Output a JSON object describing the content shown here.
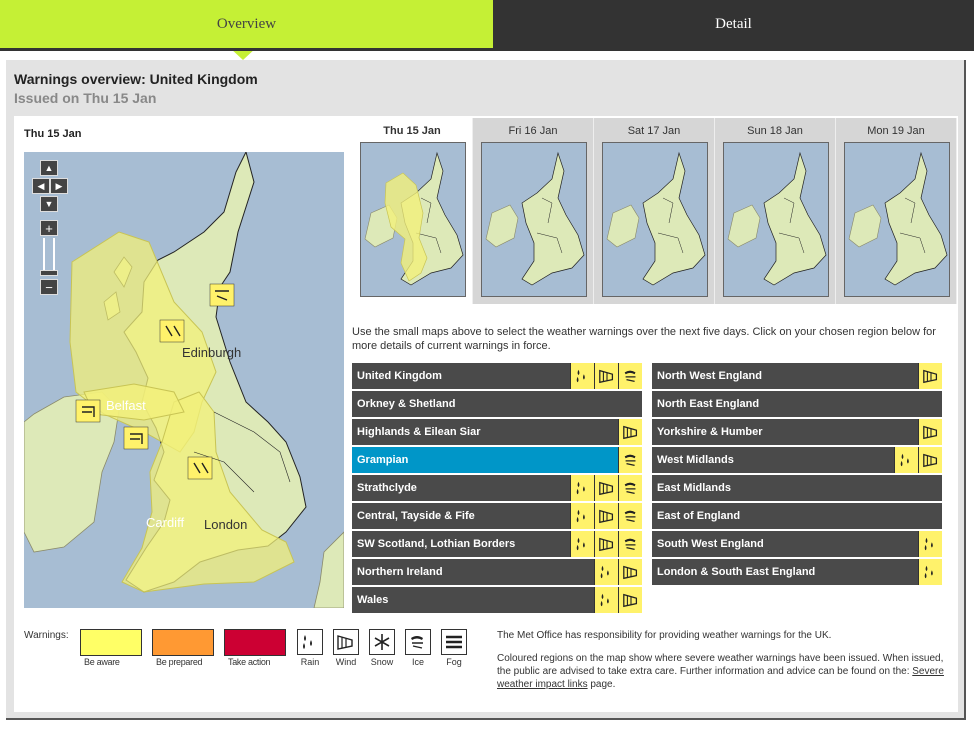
{
  "tabs": {
    "overview": "Overview",
    "detail": "Detail"
  },
  "header": {
    "title": "Warnings overview: United Kingdom",
    "issued": "Issued on Thu 15 Jan"
  },
  "main_map": {
    "date": "Thu 15 Jan",
    "labels": {
      "edinburgh": "Edinburgh",
      "belfast": "Belfast",
      "cardiff": "Cardiff",
      "london": "London"
    }
  },
  "thumbnails": [
    {
      "label": "Thu 15 Jan",
      "active": true
    },
    {
      "label": "Fri 16 Jan",
      "active": false
    },
    {
      "label": "Sat 17 Jan",
      "active": false
    },
    {
      "label": "Sun 18 Jan",
      "active": false
    },
    {
      "label": "Mon 19 Jan",
      "active": false
    }
  ],
  "instructions": "Use the small maps above to select the weather warnings over the next five days. Click on your chosen region below for more details of current warnings in force.",
  "regions_left": [
    {
      "name": "United Kingdom",
      "icons": [
        "rain-icon",
        "wind-icon",
        "ice-icon"
      ]
    },
    {
      "name": "Orkney & Shetland",
      "icons": []
    },
    {
      "name": "Highlands & Eilean Siar",
      "icons": [
        "wind-icon"
      ]
    },
    {
      "name": "Grampian",
      "icons": [
        "ice-icon"
      ],
      "selected": true
    },
    {
      "name": "Strathclyde",
      "icons": [
        "rain-icon",
        "wind-icon",
        "ice-icon"
      ]
    },
    {
      "name": "Central, Tayside & Fife",
      "icons": [
        "rain-icon",
        "wind-icon",
        "ice-icon"
      ]
    },
    {
      "name": "SW Scotland, Lothian Borders",
      "icons": [
        "rain-icon",
        "wind-icon",
        "ice-icon"
      ]
    },
    {
      "name": "Northern Ireland",
      "icons": [
        "rain-icon",
        "wind-icon"
      ]
    },
    {
      "name": "Wales",
      "icons": [
        "rain-icon",
        "wind-icon"
      ]
    }
  ],
  "regions_right": [
    {
      "name": "North West England",
      "icons": [
        "wind-icon"
      ]
    },
    {
      "name": "North East England",
      "icons": []
    },
    {
      "name": "Yorkshire & Humber",
      "icons": [
        "wind-icon"
      ]
    },
    {
      "name": "West Midlands",
      "icons": [
        "rain-icon",
        "wind-icon"
      ]
    },
    {
      "name": "East Midlands",
      "icons": []
    },
    {
      "name": "East of England",
      "icons": []
    },
    {
      "name": "South West England",
      "icons": [
        "rain-icon"
      ]
    },
    {
      "name": "London & South East England",
      "icons": [
        "rain-icon"
      ]
    }
  ],
  "legend": {
    "label": "Warnings:",
    "levels": [
      {
        "label": "Be aware",
        "color": "#ffff66"
      },
      {
        "label": "Be prepared",
        "color": "#ff9933"
      },
      {
        "label": "Take action",
        "color": "#cc0033"
      }
    ],
    "types": [
      {
        "label": "Rain",
        "icon": "rain-icon"
      },
      {
        "label": "Wind",
        "icon": "wind-icon"
      },
      {
        "label": "Snow",
        "icon": "snow-icon"
      },
      {
        "label": "Ice",
        "icon": "ice-icon"
      },
      {
        "label": "Fog",
        "icon": "fog-icon"
      }
    ]
  },
  "info": {
    "line1": "The Met Office has responsibility for providing weather warnings for the UK.",
    "line2": "Coloured regions on the map show where severe weather warnings have been issued. When issued, the public are advised to take extra care. Further information and advice can be found on the:",
    "link": "Severe weather impact links",
    "suffix": "page."
  },
  "colors": {
    "accent": "#c5f035",
    "dark": "#333333",
    "selected": "#0096c8",
    "warning_yellow": "#fff26b",
    "sea": "#a7bdd3",
    "land": "#dde9b8"
  }
}
